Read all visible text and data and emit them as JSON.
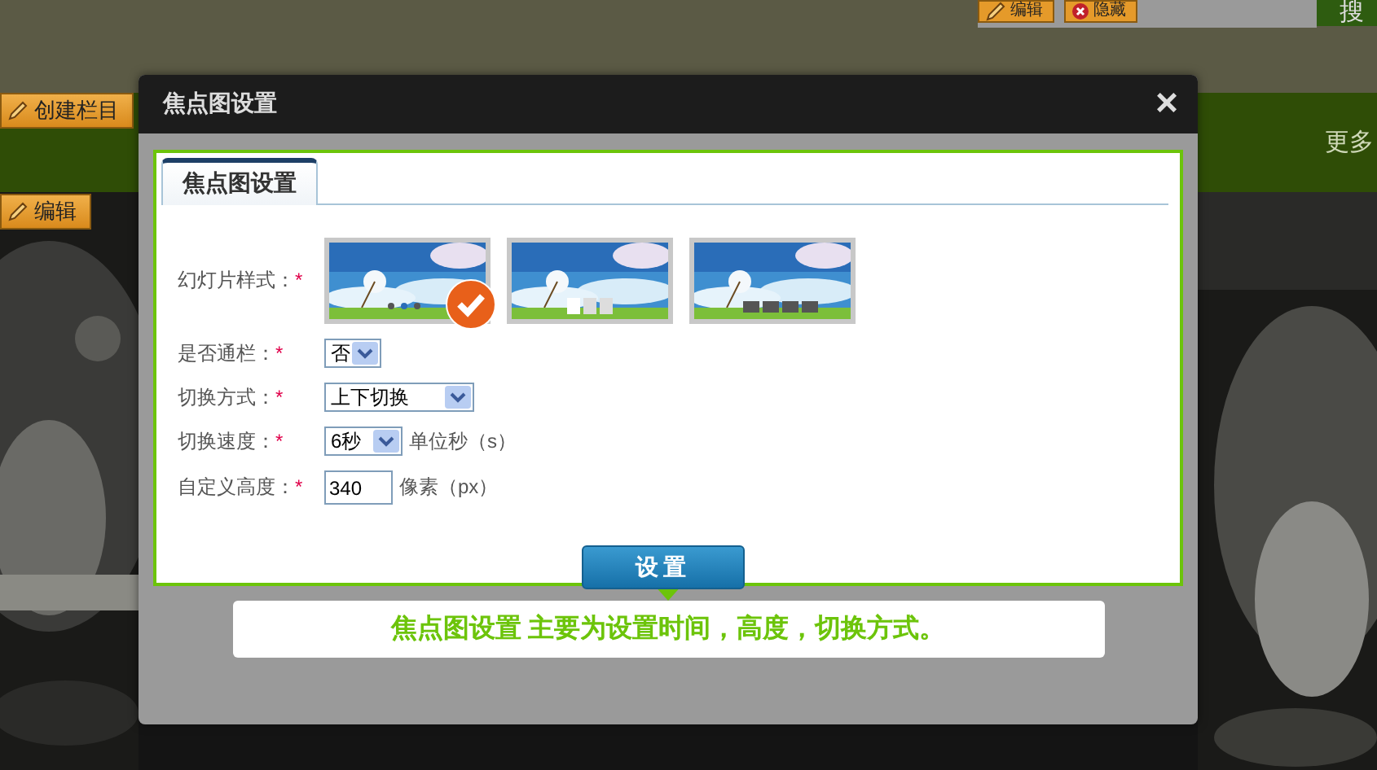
{
  "page": {
    "top_buttons": [
      {
        "label": "编辑",
        "kind": "edit"
      },
      {
        "label": "隐藏",
        "kind": "hide"
      }
    ],
    "search_button": "搜",
    "create_button": "创建栏目",
    "nav_more": "更多",
    "edit_button": "编辑"
  },
  "dialog": {
    "title": "焦点图设置",
    "close": "×",
    "tabs": [
      {
        "label": "焦点图设置",
        "selected": true
      }
    ],
    "slide_style": {
      "label": "幻灯片样式：",
      "mark": "*",
      "options": [
        {
          "kind": "dots",
          "selected": true
        },
        {
          "kind": "numbers",
          "selected": false
        },
        {
          "kind": "bars",
          "selected": false
        }
      ]
    },
    "fields": [
      {
        "kind": "select",
        "label": "是否通栏：",
        "mark": "*",
        "value": "否"
      },
      {
        "kind": "select",
        "label": "切换方式：",
        "mark": "*",
        "value": "上下切换"
      },
      {
        "kind": "select",
        "label": "切换速度：",
        "mark": "*",
        "value": "6秒",
        "unit": "单位秒（s）"
      },
      {
        "kind": "input",
        "label": "自定义高度：",
        "mark": "*",
        "value": "340",
        "unit": "像素（px）"
      }
    ],
    "submit": "设置",
    "note": "焦点图设置 主要为设置时间，高度，切换方式。"
  }
}
